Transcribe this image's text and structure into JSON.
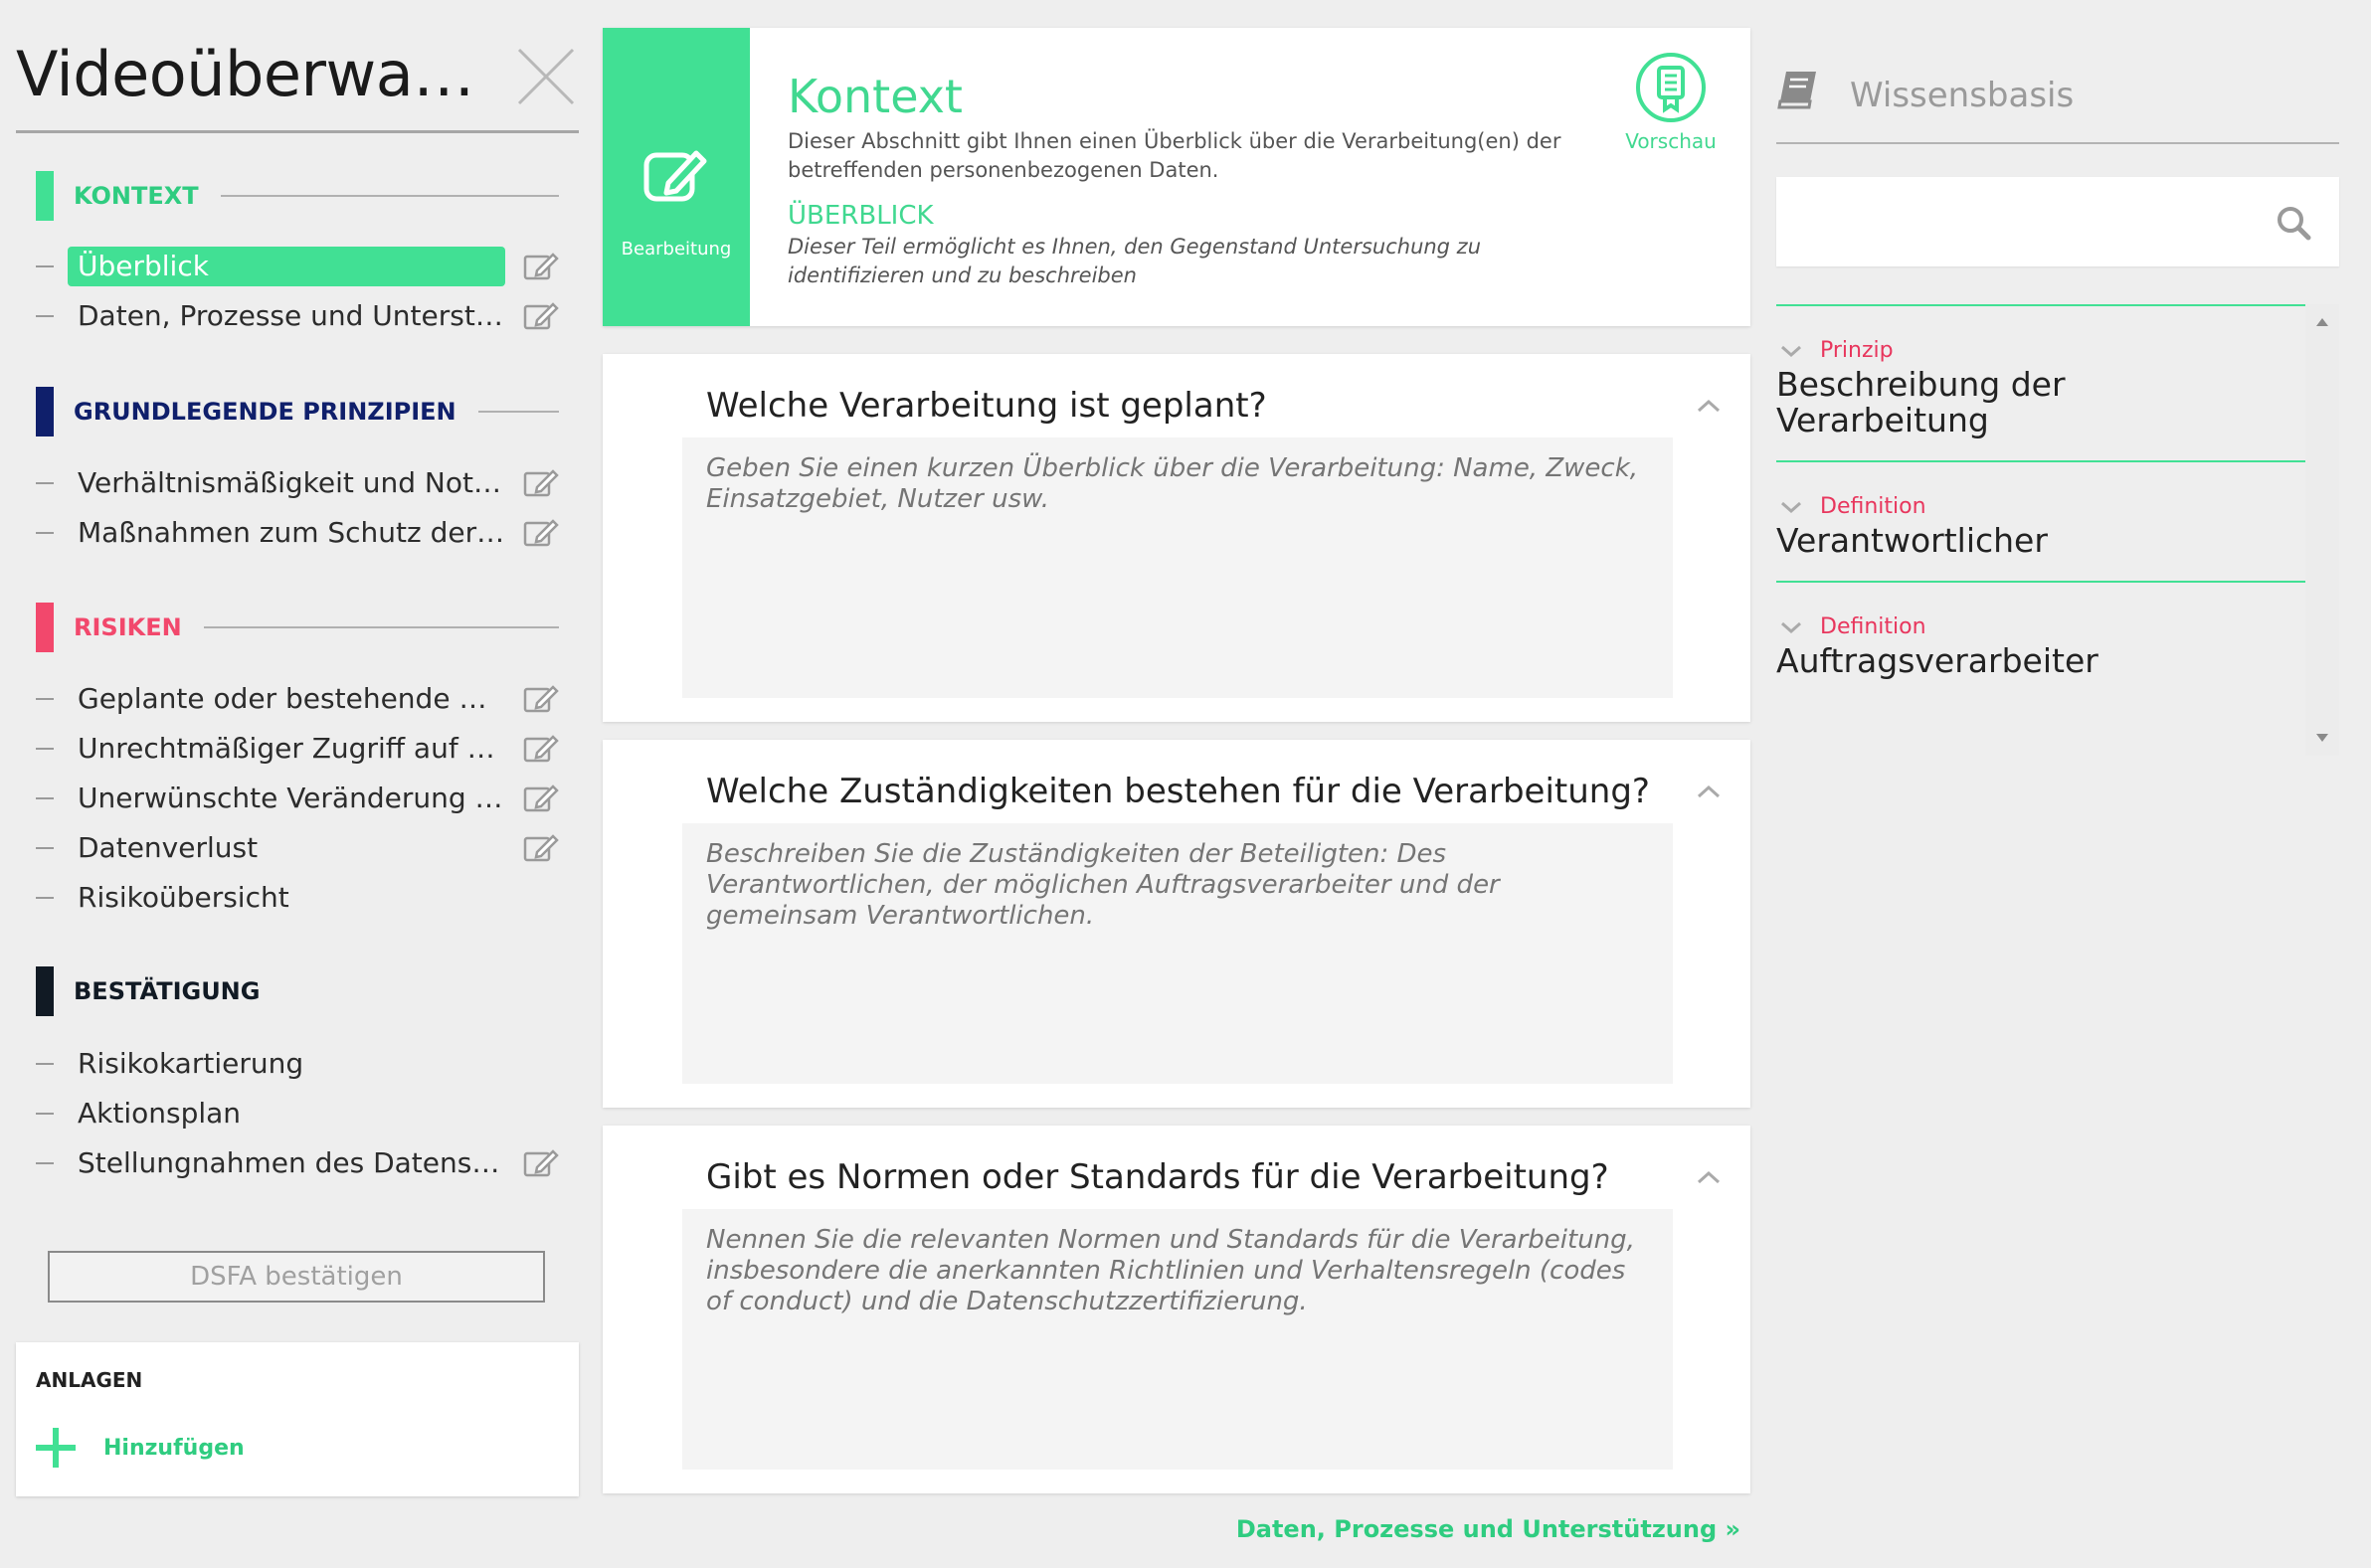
{
  "sidebar": {
    "title": "Videoüberwachung",
    "sections": [
      {
        "label": "KONTEXT",
        "color": "#41e094",
        "items": [
          {
            "label": "Überblick",
            "active": true,
            "editable": true
          },
          {
            "label": "Daten, Prozesse und Unterstützung",
            "active": false,
            "editable": true
          }
        ]
      },
      {
        "label": "GRUNDLEGENDE PRINZIPIEN",
        "color": "#0f1f6b",
        "items": [
          {
            "label": "Verhältnismäßigkeit und Notwendigkeit",
            "active": false,
            "editable": true
          },
          {
            "label": "Maßnahmen zum Schutz der Personen",
            "active": false,
            "editable": true
          }
        ]
      },
      {
        "label": "RISIKEN",
        "color": "#f2486c",
        "items": [
          {
            "label": "Geplante oder bestehende Maßnahmen",
            "active": false,
            "editable": true
          },
          {
            "label": "Unrechtmäßiger Zugriff auf Daten",
            "active": false,
            "editable": true
          },
          {
            "label": "Unerwünschte Veränderung von Daten",
            "active": false,
            "editable": true
          },
          {
            "label": "Datenverlust",
            "active": false,
            "editable": true
          },
          {
            "label": "Risikoübersicht",
            "active": false,
            "editable": false
          }
        ]
      },
      {
        "label": "BESTÄTIGUNG",
        "color": "#111a24",
        "items": [
          {
            "label": "Risikokartierung",
            "active": false,
            "editable": false
          },
          {
            "label": "Aktionsplan",
            "active": false,
            "editable": false
          },
          {
            "label": "Stellungnahmen des Datenschutzbeauftragten",
            "active": false,
            "editable": true
          }
        ]
      }
    ],
    "validate_label": "DSFA bestätigen",
    "attachments": {
      "heading": "ANLAGEN",
      "add_label": "Hinzufügen"
    }
  },
  "header": {
    "edit_mode_label": "Bearbeitung",
    "title": "Kontext",
    "description": "Dieser Abschnitt gibt Ihnen einen Überblick über die Verarbeitung(en) der betreffenden personenbezogenen Daten.",
    "subtitle": "ÜBERBLICK",
    "subdescription": "Dieser Teil ermöglicht es Ihnen, den Gegenstand Untersuchung zu identifizieren und zu beschreiben",
    "preview_label": "Vorschau"
  },
  "questions": [
    {
      "question": "Welche Verarbeitung ist geplant?",
      "placeholder": "Geben Sie einen kurzen Überblick über die Verarbeitung: Name, Zweck, Einsatzgebiet, Nutzer usw."
    },
    {
      "question": "Welche Zuständigkeiten bestehen für die Verarbeitung?",
      "placeholder": "Beschreiben Sie die Zuständigkeiten der Beteiligten: Des Verantwortlichen, der möglichen Auftragsverarbeiter und der gemeinsam Verantwortlichen."
    },
    {
      "question": "Gibt es Normen oder Standards für die Verarbeitung?",
      "placeholder": "Nennen Sie die relevanten Normen und Standards für die Verarbeitung, insbesondere die anerkannten Richtlinien und Verhaltensregeln (codes of conduct) und die Datenschutzzertifizierung."
    }
  ],
  "next_link": "Daten, Prozesse und Unterstützung »",
  "knowledge_base": {
    "title": "Wissensbasis",
    "search_placeholder": "",
    "items": [
      {
        "category": "Prinzip",
        "name": "Beschreibung der Verarbeitung"
      },
      {
        "category": "Definition",
        "name": "Verantwortlicher"
      },
      {
        "category": "Definition",
        "name": "Auftragsverarbeiter"
      }
    ]
  }
}
